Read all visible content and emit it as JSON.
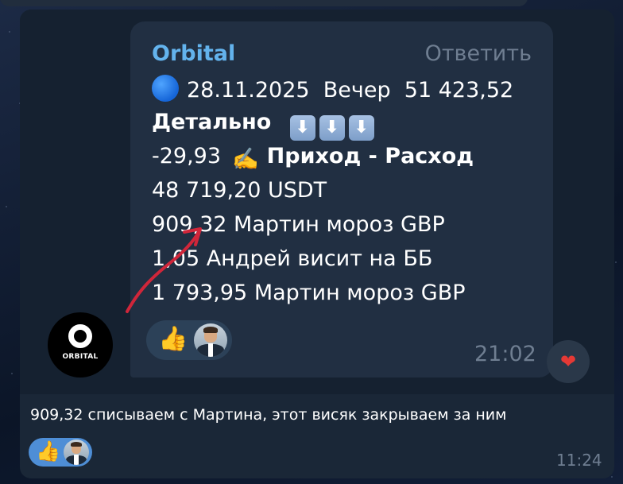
{
  "forwarded_message": {
    "sender": "Orbital",
    "reply_label": "Ответить",
    "date_line": {
      "date": "28.11.2025",
      "period": "Вечер",
      "amount": "51 423,52"
    },
    "detail_heading": "Детально",
    "detail_arrows": [
      "⬇",
      "⬇",
      "⬇"
    ],
    "income_line": {
      "value": "-29,93",
      "label": "Приход - Расход"
    },
    "lines": [
      "48 719,20  USDT",
      "909,32  Мартин мороз GBP",
      "1,05  Андрей висит на ББ",
      "1 793,95  Мартин мороз GBP"
    ],
    "time": "21:02",
    "reactions": [
      "thumbs-up",
      "person-avatar"
    ]
  },
  "channel_avatar": {
    "text": "ORBITAL"
  },
  "reply_message": {
    "text": "909,32 списываем с Мартина, этот висяк закрываем за ним",
    "time": "11:24",
    "reactions": [
      "thumbs-up",
      "person-avatar"
    ]
  },
  "icons": {
    "blue_circle": "blue-circle-icon",
    "hand": "writing-hand-icon",
    "heart": "heart-icon",
    "thumb": "👍",
    "writing_hand": "✍️",
    "heart_glyph": "❤"
  },
  "colors": {
    "sender": "#63b3ed",
    "meta": "#6f7e91",
    "annotation_arrow": "#d0263a",
    "heart": "#e53935"
  }
}
